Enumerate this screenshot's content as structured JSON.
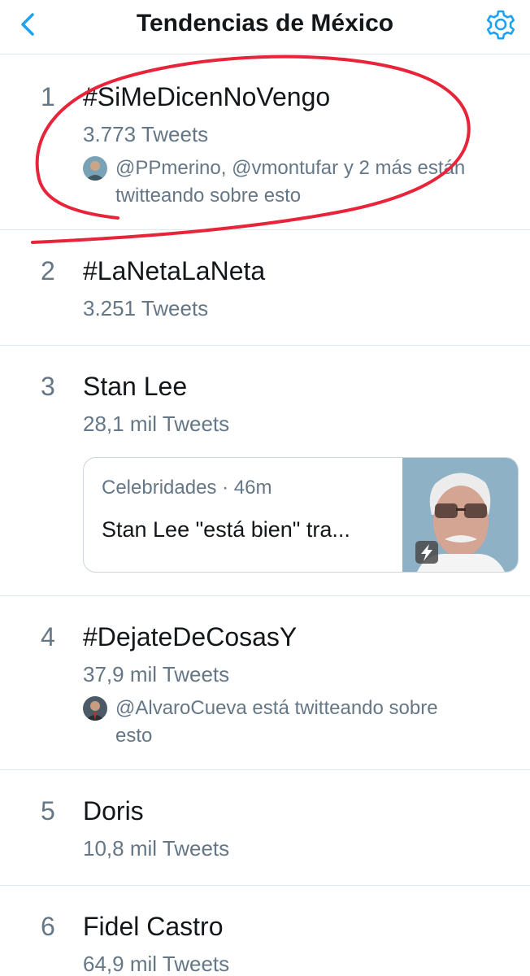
{
  "header": {
    "title": "Tendencias de México",
    "back_icon": "chevron-left-icon",
    "settings_icon": "gear-icon",
    "accent": "#1da1f2"
  },
  "trends": [
    {
      "rank": "1",
      "name": "#SiMeDicenNoVengo",
      "count": "3.773 Tweets",
      "context": "@PPmerino, @vmontufar y 2 más están twitteando sobre esto"
    },
    {
      "rank": "2",
      "name": "#LaNetaLaNeta",
      "count": "3.251 Tweets"
    },
    {
      "rank": "3",
      "name": "Stan Lee",
      "count": "28,1 mil Tweets",
      "card": {
        "category": "Celebridades",
        "time": "46m",
        "headline": "Stan Lee \"está bien\" tra...",
        "thumb_icon": "lightning-icon"
      }
    },
    {
      "rank": "4",
      "name": "#DejateDeCosasY",
      "count": "37,9 mil Tweets",
      "context": "@AlvaroCueva está twitteando sobre esto"
    },
    {
      "rank": "5",
      "name": "Doris",
      "count": "10,8 mil Tweets"
    },
    {
      "rank": "6",
      "name": "Fidel Castro",
      "count": "64,9 mil Tweets"
    }
  ],
  "annotation_color": "#e8243a"
}
